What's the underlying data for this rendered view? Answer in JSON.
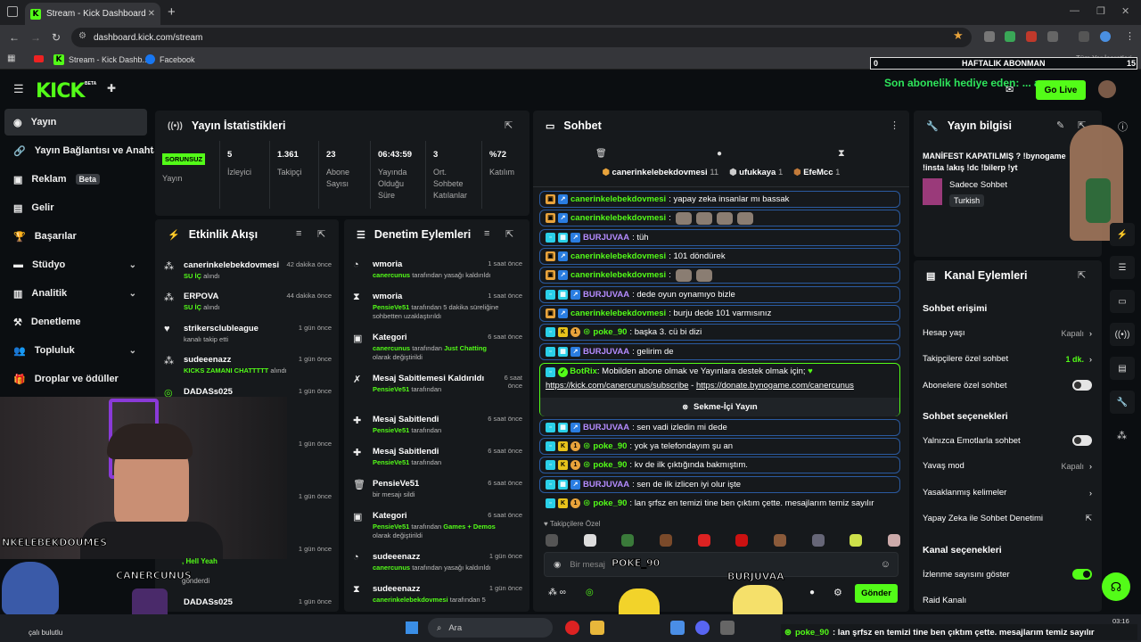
{
  "browser": {
    "tab_title": "Stream - Kick Dashboard",
    "url": "dashboard.kick.com/stream",
    "bookmarks": [
      "Stream - Kick Dashb...",
      "Facebook"
    ],
    "bookmarks_right": "Tüm Yer İşaretleri"
  },
  "header": {
    "logo": "KICK",
    "beta": "BETA",
    "go_live": "Go Live",
    "weekly_left": "0",
    "weekly_label": "HAFTALIK ABONMAN",
    "weekly_right": "15",
    "last_sub": "Son abonelik hediye eden: ... azz"
  },
  "sidebar": {
    "items": [
      {
        "label": "Yayın",
        "icon": "broadcast-icon"
      },
      {
        "label": "Yayın Bağlantısı ve Anahtar",
        "icon": "link-icon"
      },
      {
        "label": "Reklam",
        "icon": "ad-icon",
        "badge": "Beta"
      },
      {
        "label": "Gelir",
        "icon": "revenue-icon"
      },
      {
        "label": "Başarılar",
        "icon": "trophy-icon"
      },
      {
        "label": "Stüdyo",
        "icon": "studio-icon"
      },
      {
        "label": "Analitik",
        "icon": "analytics-icon"
      },
      {
        "label": "Denetleme",
        "icon": "moderation-icon"
      },
      {
        "label": "Topluluk",
        "icon": "community-icon"
      },
      {
        "label": "Droplar ve ödüller",
        "icon": "drops-icon"
      }
    ]
  },
  "stats": {
    "title": "Yayın İstatistikleri",
    "status": "SORUNSUZ",
    "status_label": "Yayın",
    "cols": [
      {
        "value": "5",
        "label": "İzleyici"
      },
      {
        "value": "1.361",
        "label": "Takipçi"
      },
      {
        "value": "23",
        "label": "Abone Sayısı"
      },
      {
        "value": "06:43:59",
        "label": "Yayında Olduğu Süre"
      },
      {
        "value": "3",
        "label": "Ort. Sohbete Katılanlar"
      },
      {
        "value": "%72",
        "label": "Katılım"
      }
    ]
  },
  "activity": {
    "title": "Etkinlik Akışı",
    "rows": [
      {
        "name": "canerinkelebekdovmesi",
        "sub": "SU İÇ",
        "sub_suffix": "alındı",
        "time": "42 dakika önce"
      },
      {
        "name": "ERPOVA",
        "sub": "SU İÇ",
        "sub_suffix": "alındı",
        "time": "44 dakika önce"
      },
      {
        "name": "strikersclubleague",
        "desc": "kanalı takip etti",
        "time": "1 gün önce"
      },
      {
        "name": "sudeeenazz",
        "sub": "KICKS ZAMANI CHATTTTT",
        "sub_suffix": "alındı",
        "time": "1 gün önce"
      },
      {
        "name": "DADASs025",
        "time": "1 gün önce"
      },
      {
        "name": "",
        "time": "1 gün önce"
      },
      {
        "name": "",
        "time": "1 gün önce"
      },
      {
        "name": "",
        "time": "1 gün önce"
      },
      {
        "name": "DADASs025",
        "time": "1 gün önce"
      }
    ],
    "peek_text": ", Hell Yeah",
    "peek_sub": "gönderdi"
  },
  "moderation": {
    "title": "Denetim Eylemleri",
    "rows": [
      {
        "name": "wmoria",
        "by": "canercunus",
        "desc": "tarafından yasağı kaldırıldı",
        "time": "1 saat önce"
      },
      {
        "name": "wmoria",
        "by": "PensieVe51",
        "desc": "tarafından 5 dakika süreliğine sohbetten uzaklaştırıldı",
        "time": "1 saat önce"
      },
      {
        "name": "Kategori",
        "by": "canercunus",
        "desc": "tarafından",
        "extra": "Just Chatting",
        "desc2": "olarak değiştirildi",
        "time": "6 saat önce"
      },
      {
        "name": "Mesaj Sabitlemesi Kaldırıldı",
        "by": "PensieVe51",
        "desc": "tarafından",
        "time": "6 saat önce"
      },
      {
        "name": "Mesaj Sabitlendi",
        "by": "PensieVe51",
        "desc": "tarafından",
        "time": "6 saat önce"
      },
      {
        "name": "Mesaj Sabitlendi",
        "by": "PensieVe51",
        "desc": "tarafından",
        "time": "6 saat önce"
      },
      {
        "name": "PensieVe51",
        "desc_plain": "bir mesajı sildi",
        "time": "6 saat önce"
      },
      {
        "name": "Kategori",
        "by": "PensieVe51",
        "desc": "tarafından",
        "extra": "Games + Demos",
        "desc2": "olarak değiştirildi",
        "time": "6 saat önce"
      },
      {
        "name": "sudeeenazz",
        "by": "canercunus",
        "desc": "tarafından yasağı kaldırıldı",
        "time": "1 gün önce"
      },
      {
        "name": "sudeeenazz",
        "by": "canerinkelebekdovmesi",
        "desc": "tarafından 5",
        "time": "1 gün önce"
      }
    ]
  },
  "chat": {
    "title": "Sohbet",
    "top_users": [
      {
        "name": "canerinkelebekdovmesi",
        "count": "11"
      },
      {
        "name": "ufukkaya",
        "count": "1"
      },
      {
        "name": "EfeMcc",
        "count": "1"
      }
    ],
    "messages": [
      {
        "user": "canerinkelebekdovmesi",
        "color": "green",
        "text": ": yapay zeka insanlar mı bassak"
      },
      {
        "user": "canerinkelebekdovmesi",
        "color": "green",
        "text": ":",
        "emotes": 4
      },
      {
        "user": "BURJUVAA",
        "color": "purple",
        "text": ": tüh"
      },
      {
        "user": "canerinkelebekdovmesi",
        "color": "green",
        "text": ": 101 döndürek"
      },
      {
        "user": "canerinkelebekdovmesi",
        "color": "green",
        "text": ":",
        "emotes": 2
      },
      {
        "user": "BURJUVAA",
        "color": "purple",
        "text": ": dede oyun oynamıyo bizle"
      },
      {
        "user": "canerinkelebekdovmesi",
        "color": "green",
        "text": ": burju dede 101 varmısınız"
      },
      {
        "user": "poke_90",
        "color": "green",
        "text": ": başka 3. cü bi dizi"
      },
      {
        "user": "BURJUVAA",
        "color": "purple",
        "text": ": gelirim de"
      }
    ],
    "bot": {
      "user": "BotRix",
      "text": ": Mobilden abone olmak ve Yayınlara destek olmak için;",
      "link1": "https://kick.com/canercunus/subscribe",
      "sep": " - ",
      "link2": "https://donate.bynogame.com/canercunus",
      "button": "Sekme-İçi Yayın"
    },
    "messages2": [
      {
        "user": "BURJUVAA",
        "color": "purple",
        "text": ": sen vadi izledin mi dede"
      },
      {
        "user": "poke_90",
        "color": "green",
        "text": ": yok ya telefondayım şu an"
      },
      {
        "user": "poke_90",
        "color": "green",
        "text": ": kv de ilk çıktığında bakmıştım."
      },
      {
        "user": "BURJUVAA",
        "color": "purple",
        "text": ": sen de ilk izlicen iyi olur işte"
      },
      {
        "user": "poke_90",
        "color": "green",
        "text": ": lan şrfsz en temizi tine ben çıktım çette. mesajlarım temiz sayılır"
      }
    ],
    "followers_only": "Takipçilere Özel",
    "input_placeholder": "Bir mesaj",
    "send": "Gönder"
  },
  "stream_info": {
    "title": "Yayın bilgisi",
    "stream_title": "MANİFEST KAPATILMIŞ ? !bynogame !insta !akış !dc !bilerp !yt",
    "category": "Sadece Sohbet",
    "tag": "Turkish"
  },
  "channel_actions": {
    "title": "Kanal Eylemleri",
    "chat_access": "Sohbet erişimi",
    "rows_access": [
      {
        "label": "Hesap yaşı",
        "value": "Kapalı",
        "kind": "chevron"
      },
      {
        "label": "Takipçilere özel sohbet",
        "value": "1 dk.",
        "kind": "chevron"
      },
      {
        "label": "Abonelere özel sohbet",
        "kind": "toggle"
      }
    ],
    "chat_options": "Sohbet seçenekleri",
    "rows_options": [
      {
        "label": "Yalnızca Emotlarla sohbet",
        "kind": "toggle"
      },
      {
        "label": "Yavaş mod",
        "value": "Kapalı",
        "kind": "chevron"
      },
      {
        "label": "Yasaklanmış kelimeler",
        "kind": "chevron"
      },
      {
        "label": "Yapay Zeka ile Sohbet Denetimi",
        "kind": "external"
      }
    ],
    "channel_options": "Kanal seçenekleri",
    "rows_channel": [
      {
        "label": "İzlenme sayısını göster",
        "kind": "toggle-on"
      },
      {
        "label": "Raid Kanalı",
        "kind": "none"
      }
    ]
  },
  "overlay": {
    "webcam_name": "NKELEBEKDOUMES",
    "streamer_name": "CANERCUNUS",
    "pikachu_name": "POKE_90",
    "ppg_name": "BURJUVAA",
    "ticker_user": "poke_90",
    "ticker_text": ": lan şrfsz en temizi tine ben çıktım çette. mesajlarım temiz sayılır",
    "weather": "çalı bulutlu"
  },
  "taskbar": {
    "search": "Ara",
    "time": "03:16"
  }
}
